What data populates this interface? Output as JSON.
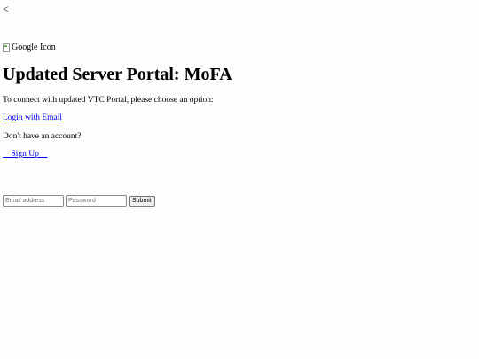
{
  "nav": {
    "back_label": "<"
  },
  "logo": {
    "alt_text": "Google Icon",
    "icon": "broken-image-icon"
  },
  "header": {
    "title": "Updated Server Portal: MoFA"
  },
  "content": {
    "intro_text": "To connect with updated VTC Portal, please choose an option:",
    "email_login_link": "Login with Email",
    "no_account_text": "Don't have an account?",
    "signup_link": "    Sign Up    "
  },
  "form": {
    "email_placeholder": "Email address",
    "password_placeholder": "Password",
    "submit_label": "Submit"
  },
  "colors": {
    "background": "#fdfcff",
    "link": "#0000ee"
  }
}
